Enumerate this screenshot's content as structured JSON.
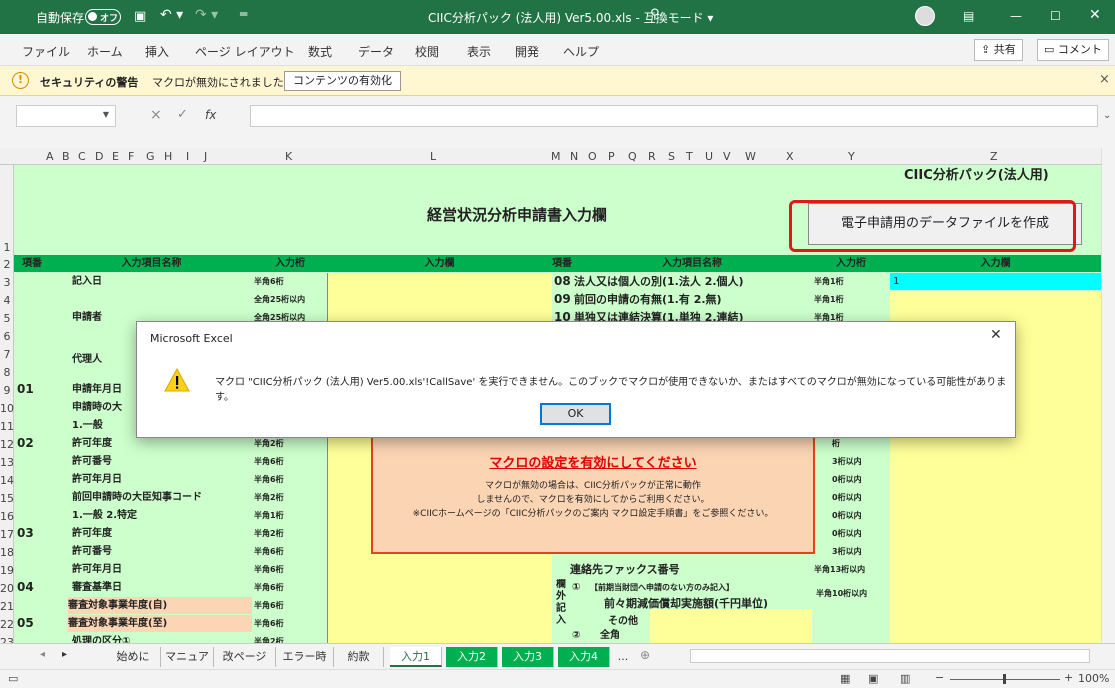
{
  "titlebar": {
    "autosave": "自動保存",
    "autosave_state": "オフ",
    "document_title": "CIIC分析パック (法人用) Ver5.00.xls  -  互換モード  ▾"
  },
  "ribbon_tabs": [
    "ファイル",
    "ホーム",
    "挿入",
    "ページ レイアウト",
    "数式",
    "データ",
    "校閲",
    "表示",
    "開発",
    "ヘルプ"
  ],
  "share_label": "共有",
  "comment_label": "コメント",
  "security": {
    "title": "セキュリティの警告",
    "message": "マクロが無効にされました。",
    "button": "コンテンツの有効化"
  },
  "formula_bar": {
    "name_box": "",
    "fx": "fx",
    "content": ""
  },
  "columns": [
    "A",
    "B",
    "C",
    "D",
    "E",
    "F",
    "G",
    "H",
    "I",
    "J",
    "K",
    "L",
    "M",
    "N",
    "O",
    "P",
    "Q",
    "R",
    "S",
    "T",
    "U",
    "V",
    "W",
    "X",
    "Y",
    "Z"
  ],
  "rows": [
    "1",
    "2",
    "3",
    "4",
    "5",
    "6",
    "7",
    "8",
    "9",
    "10",
    "11",
    "12",
    "13",
    "14",
    "15",
    "16",
    "17",
    "18",
    "19",
    "20",
    "21",
    "22",
    "23"
  ],
  "sheet": {
    "main_title": "経営状況分析申請書入力欄",
    "pack_title": "CIIC分析パック(法人用)",
    "create_file_button": "電子申請用のデータファイルを作成",
    "left_header": {
      "no": "項番",
      "name": "入力項目名称",
      "digits": "入力桁",
      "field": "入力欄"
    },
    "right_header": {
      "no": "項番",
      "name": "入力項目名称",
      "digits": "入力桁",
      "field": "入力欄"
    },
    "left_rows": [
      {
        "no": "",
        "name": "記入日",
        "digits": "半角6桁"
      },
      {
        "no": "",
        "name": "",
        "digits": "全角25桁以内"
      },
      {
        "no": "",
        "name": "申請者",
        "digits": "全角25桁以内"
      },
      {
        "no": "",
        "name": "",
        "digits": ""
      },
      {
        "no": "",
        "name": "代理人",
        "digits": ""
      },
      {
        "no": "",
        "name": "",
        "digits": ""
      },
      {
        "no": "01",
        "name": "申請年月日",
        "digits": ""
      },
      {
        "no": "",
        "name": "申請時の大",
        "digits": ""
      },
      {
        "no": "",
        "name": "  1.一般",
        "digits": ""
      },
      {
        "no": "02",
        "name": "  許可年度",
        "digits": "半角2桁"
      },
      {
        "no": "",
        "name": "  許可番号",
        "digits": "半角6桁"
      },
      {
        "no": "",
        "name": "  許可年月日",
        "digits": "半角6桁"
      },
      {
        "no": "",
        "name": "前回申請時の大臣知事コード",
        "digits": "半角2桁"
      },
      {
        "no": "",
        "name": "  1.一般  2.特定",
        "digits": "半角1桁"
      },
      {
        "no": "03",
        "name": "  許可年度",
        "digits": "半角2桁"
      },
      {
        "no": "",
        "name": "  許可番号",
        "digits": "半角6桁"
      },
      {
        "no": "",
        "name": "  許可年月日",
        "digits": "半角6桁"
      },
      {
        "no": "04",
        "name": "審査基準日",
        "digits": "半角6桁"
      },
      {
        "no": "",
        "name": "審査対象事業年度(自)",
        "digits": "半角6桁"
      },
      {
        "no": "05",
        "name": "審査対象事業年度(至)",
        "digits": "半角6桁"
      },
      {
        "no": "",
        "name": "  処理の区分①",
        "digits": "半角2桁"
      }
    ],
    "right_rows": [
      {
        "no": "08",
        "name": "法人又は個人の別(1.法人 2.個人)",
        "digits": "半角1桁",
        "value": "1"
      },
      {
        "no": "09",
        "name": "前回の申請の有無(1.有 2.無)",
        "digits": "半角1桁",
        "value": ""
      },
      {
        "no": "10",
        "name": "単独又は連結決算(1.単独 2.連結)",
        "digits": "半角1桁",
        "value": ""
      }
    ],
    "right_lower_digits": [
      "桁",
      "3桁以内",
      "0桁以内",
      "0桁以内",
      "0桁以内",
      "0桁以内",
      "3桁以内"
    ],
    "fax_label": "連絡先ファックス番号",
    "fax_digits": "半角13桁以内",
    "bottom": {
      "sidebar": "欄外記入",
      "circle1": "①",
      "note1": "【前期当財団へ申請のない方のみ記入】",
      "depreciation": "前々期減価償却実施額(千円単位)",
      "depr_digits": "半角10桁以内",
      "circle2": "②",
      "other": "その他",
      "fullwidth": "全角"
    },
    "macro_notice": {
      "title": "マクロの設定を有効にしてください",
      "line1": "マクロが無効の場合は、CIIC分析パックが正常に動作",
      "line2": "しませんので、マクロを有効にしてからご利用ください。",
      "line3": "※CIICホームページの「CIIC分析パックのご案内 マクロ設定手順書」をご参照ください。"
    }
  },
  "dialog": {
    "title": "Microsoft Excel",
    "message": "マクロ \"CIIC分析パック (法人用) Ver5.00.xls'!CallSave' を実行できません。このブックでマクロが使用できないか、またはすべてのマクロが無効になっている可能性があります。",
    "ok": "OK"
  },
  "sheet_tabs": [
    "始めに",
    "マニュアル",
    "改ページ",
    "エラー時",
    "約款",
    "入力1",
    "入力2",
    "入力3",
    "入力4",
    "..."
  ],
  "zoom": "100%"
}
